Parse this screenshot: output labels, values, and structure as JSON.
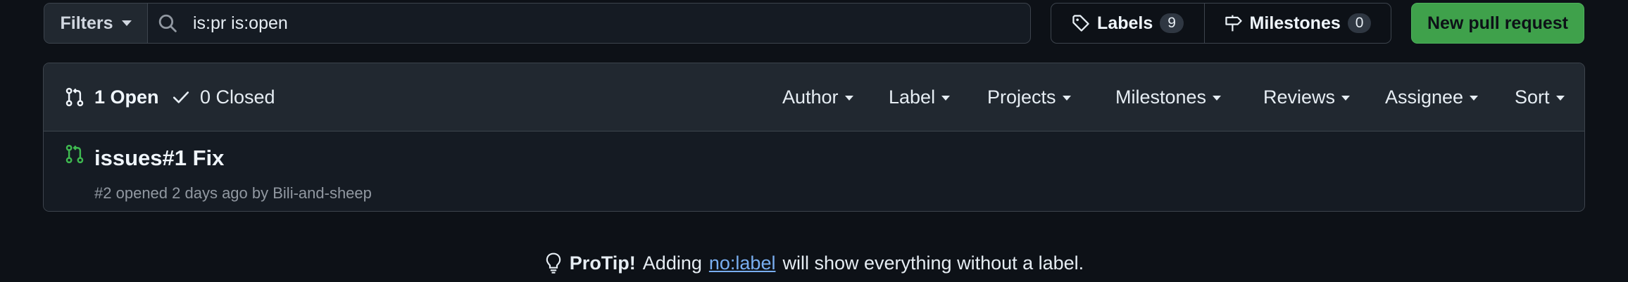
{
  "toolbar": {
    "filters_label": "Filters",
    "search_value": "is:pr is:open",
    "labels_label": "Labels",
    "labels_count": "9",
    "milestones_label": "Milestones",
    "milestones_count": "0",
    "new_pr_label": "New pull request"
  },
  "results": {
    "open_label": "1 Open",
    "closed_label": "0 Closed",
    "filters": [
      "Author",
      "Label",
      "Projects",
      "Milestones",
      "Reviews",
      "Assignee",
      "Sort"
    ],
    "items": [
      {
        "title": "issues#1 Fix",
        "number": "#2",
        "opened_text": "opened 2 days ago by",
        "author": "Bili-and-sheep"
      }
    ]
  },
  "protip": {
    "label": "ProTip!",
    "prefix": "Adding",
    "link": "no:label",
    "suffix": "will show everything without a label."
  },
  "colors": {
    "open_green": "#3fb950",
    "primary_button": "#3fa14b",
    "link": "#79aef0"
  },
  "icons": [
    "search-icon",
    "tag-icon",
    "milestone-icon",
    "pull-request-icon",
    "check-icon",
    "lightbulb-icon",
    "caret-down-icon"
  ]
}
